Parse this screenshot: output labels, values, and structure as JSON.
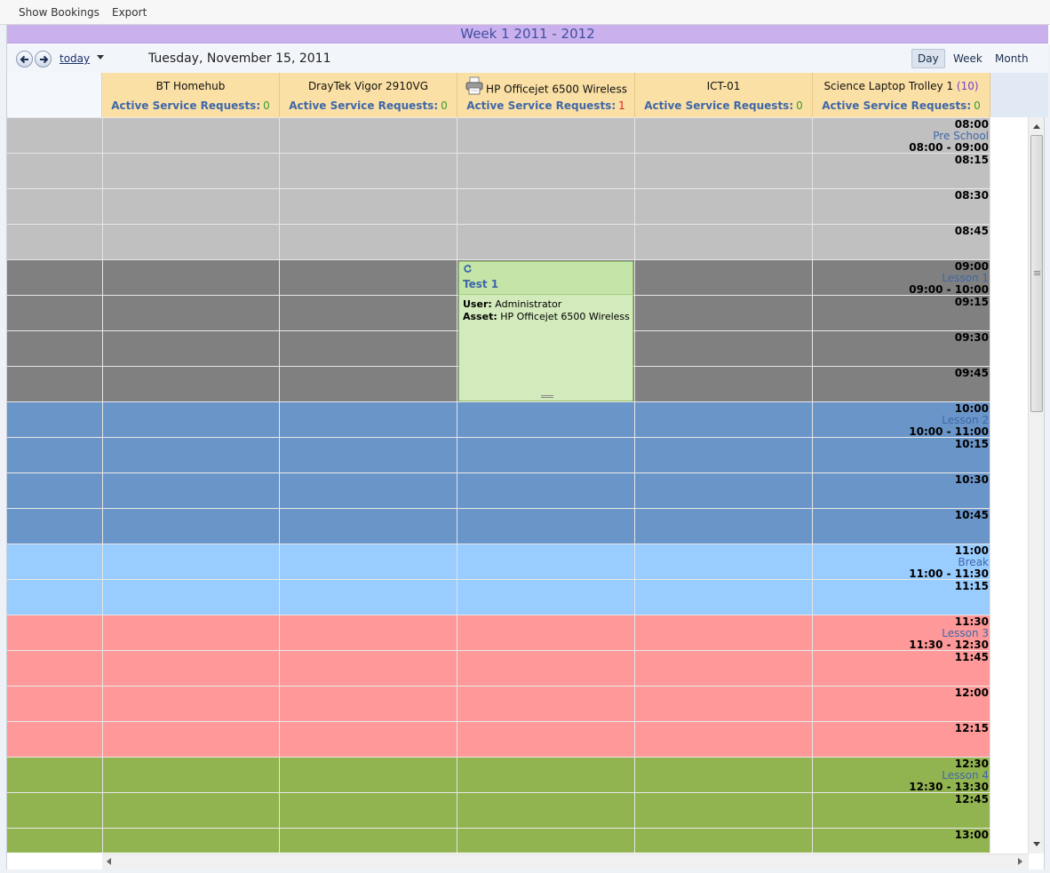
{
  "menu": {
    "show_bookings": "Show Bookings",
    "export": "Export"
  },
  "week_banner": "Week 1 2011 - 2012",
  "toolbar": {
    "today": "today",
    "date": "Tuesday, November 15, 2011",
    "views": [
      "Day",
      "Week",
      "Month"
    ],
    "active_view": "Day"
  },
  "resources": [
    {
      "name": "BT Homehub",
      "sr_label": "Active Service Requests:",
      "sr_count": "0",
      "count_color": "#3a9a2a"
    },
    {
      "name": "DrayTek Vigor 2910VG",
      "sr_label": "Active Service Requests:",
      "sr_count": "0",
      "count_color": "#3a9a2a"
    },
    {
      "name": "HP Officejet 6500 Wireless",
      "sr_label": "Active Service Requests:",
      "sr_count": "1",
      "count_color": "#e02020",
      "icon": "printer-icon"
    },
    {
      "name": "ICT-01",
      "sr_label": "Active Service Requests:",
      "sr_count": "0",
      "count_color": "#3a9a2a"
    },
    {
      "name": "Science Laptop Trolley 1",
      "name_suffix": "(10)",
      "sr_label": "Active Service Requests:",
      "sr_count": "0",
      "count_color": "#3a9a2a"
    }
  ],
  "periods": [
    {
      "name": "Pre School",
      "range": "08:00 - 09:00",
      "color": "#c0c0c0",
      "slots": [
        "08:00",
        "08:15",
        "08:30",
        "08:45"
      ]
    },
    {
      "name": "Lesson 1",
      "range": "09:00 - 10:00",
      "color": "#808080",
      "slots": [
        "09:00",
        "09:15",
        "09:30",
        "09:45"
      ]
    },
    {
      "name": "Lesson 2",
      "range": "10:00 - 11:00",
      "color": "#6a95c8",
      "slots": [
        "10:00",
        "10:15",
        "10:30",
        "10:45"
      ]
    },
    {
      "name": "Break",
      "range": "11:00 - 11:30",
      "color": "#99ccff",
      "slots": [
        "11:00",
        "11:15"
      ]
    },
    {
      "name": "Lesson 3",
      "range": "11:30 - 12:30",
      "color": "#ff9999",
      "slots": [
        "11:30",
        "11:45",
        "12:00",
        "12:15"
      ]
    },
    {
      "name": "Lesson 4",
      "range": "12:30 - 13:30",
      "color": "#92b450",
      "slots": [
        "12:30",
        "12:45",
        "13:00"
      ]
    }
  ],
  "appointment": {
    "title": "Test 1",
    "user_label": "User:",
    "user": "Administrator",
    "asset_label": "Asset:",
    "asset": "HP Officejet 6500 Wireless"
  }
}
